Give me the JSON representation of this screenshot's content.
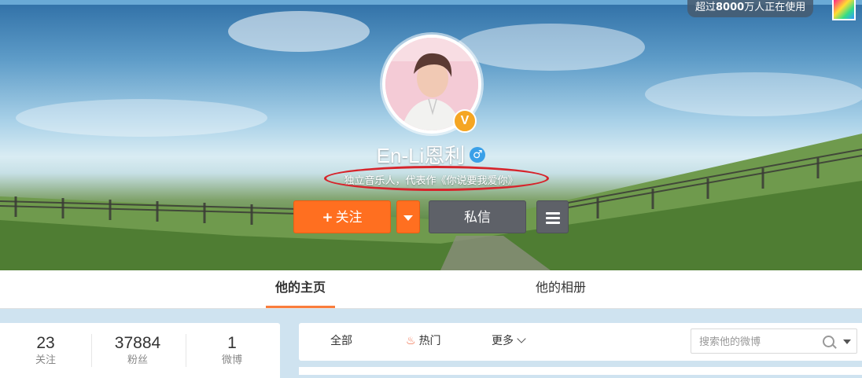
{
  "top_badge": {
    "prefix": "超过",
    "count": "8000",
    "suffix": "万人正在使用"
  },
  "profile": {
    "name": "En-Li恩利",
    "gender_symbol": "♂",
    "verified_mark": "V",
    "bio": "独立音乐人，代表作《你说要我爱你》"
  },
  "actions": {
    "follow_plus": "+",
    "follow_label": "关注",
    "message_label": "私信"
  },
  "tabs": {
    "home": "他的主页",
    "album": "他的相册"
  },
  "stats": [
    {
      "value": "23",
      "label": "关注"
    },
    {
      "value": "37884",
      "label": "粉丝"
    },
    {
      "value": "1",
      "label": "微博"
    }
  ],
  "filter": {
    "all": "全部",
    "hot": "热门",
    "more": "更多",
    "search_placeholder": "搜索他的微博"
  },
  "colors": {
    "accent_orange": "#ff6f20",
    "button_gray": "#5e6168",
    "annotation_red": "#d6242b",
    "tab_underline": "#fa7d3c"
  }
}
